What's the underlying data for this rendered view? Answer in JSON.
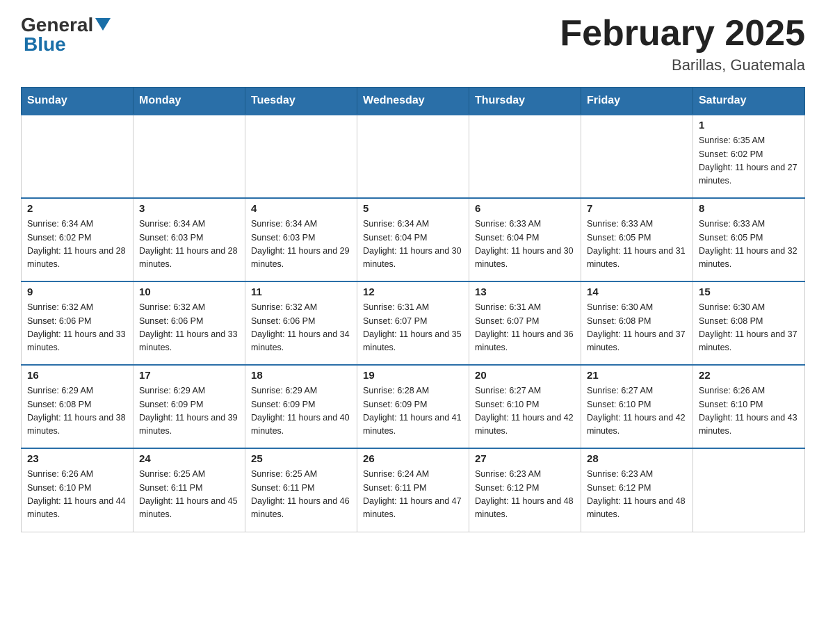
{
  "header": {
    "title": "February 2025",
    "subtitle": "Barillas, Guatemala",
    "logo_line1": "General",
    "logo_line2": "Blue"
  },
  "days_of_week": [
    "Sunday",
    "Monday",
    "Tuesday",
    "Wednesday",
    "Thursday",
    "Friday",
    "Saturday"
  ],
  "weeks": [
    [
      {
        "day": "",
        "sunrise": "",
        "sunset": "",
        "daylight": "",
        "empty": true
      },
      {
        "day": "",
        "sunrise": "",
        "sunset": "",
        "daylight": "",
        "empty": true
      },
      {
        "day": "",
        "sunrise": "",
        "sunset": "",
        "daylight": "",
        "empty": true
      },
      {
        "day": "",
        "sunrise": "",
        "sunset": "",
        "daylight": "",
        "empty": true
      },
      {
        "day": "",
        "sunrise": "",
        "sunset": "",
        "daylight": "",
        "empty": true
      },
      {
        "day": "",
        "sunrise": "",
        "sunset": "",
        "daylight": "",
        "empty": true
      },
      {
        "day": "1",
        "sunrise": "Sunrise: 6:35 AM",
        "sunset": "Sunset: 6:02 PM",
        "daylight": "Daylight: 11 hours and 27 minutes.",
        "empty": false
      }
    ],
    [
      {
        "day": "2",
        "sunrise": "Sunrise: 6:34 AM",
        "sunset": "Sunset: 6:02 PM",
        "daylight": "Daylight: 11 hours and 28 minutes.",
        "empty": false
      },
      {
        "day": "3",
        "sunrise": "Sunrise: 6:34 AM",
        "sunset": "Sunset: 6:03 PM",
        "daylight": "Daylight: 11 hours and 28 minutes.",
        "empty": false
      },
      {
        "day": "4",
        "sunrise": "Sunrise: 6:34 AM",
        "sunset": "Sunset: 6:03 PM",
        "daylight": "Daylight: 11 hours and 29 minutes.",
        "empty": false
      },
      {
        "day": "5",
        "sunrise": "Sunrise: 6:34 AM",
        "sunset": "Sunset: 6:04 PM",
        "daylight": "Daylight: 11 hours and 30 minutes.",
        "empty": false
      },
      {
        "day": "6",
        "sunrise": "Sunrise: 6:33 AM",
        "sunset": "Sunset: 6:04 PM",
        "daylight": "Daylight: 11 hours and 30 minutes.",
        "empty": false
      },
      {
        "day": "7",
        "sunrise": "Sunrise: 6:33 AM",
        "sunset": "Sunset: 6:05 PM",
        "daylight": "Daylight: 11 hours and 31 minutes.",
        "empty": false
      },
      {
        "day": "8",
        "sunrise": "Sunrise: 6:33 AM",
        "sunset": "Sunset: 6:05 PM",
        "daylight": "Daylight: 11 hours and 32 minutes.",
        "empty": false
      }
    ],
    [
      {
        "day": "9",
        "sunrise": "Sunrise: 6:32 AM",
        "sunset": "Sunset: 6:06 PM",
        "daylight": "Daylight: 11 hours and 33 minutes.",
        "empty": false
      },
      {
        "day": "10",
        "sunrise": "Sunrise: 6:32 AM",
        "sunset": "Sunset: 6:06 PM",
        "daylight": "Daylight: 11 hours and 33 minutes.",
        "empty": false
      },
      {
        "day": "11",
        "sunrise": "Sunrise: 6:32 AM",
        "sunset": "Sunset: 6:06 PM",
        "daylight": "Daylight: 11 hours and 34 minutes.",
        "empty": false
      },
      {
        "day": "12",
        "sunrise": "Sunrise: 6:31 AM",
        "sunset": "Sunset: 6:07 PM",
        "daylight": "Daylight: 11 hours and 35 minutes.",
        "empty": false
      },
      {
        "day": "13",
        "sunrise": "Sunrise: 6:31 AM",
        "sunset": "Sunset: 6:07 PM",
        "daylight": "Daylight: 11 hours and 36 minutes.",
        "empty": false
      },
      {
        "day": "14",
        "sunrise": "Sunrise: 6:30 AM",
        "sunset": "Sunset: 6:08 PM",
        "daylight": "Daylight: 11 hours and 37 minutes.",
        "empty": false
      },
      {
        "day": "15",
        "sunrise": "Sunrise: 6:30 AM",
        "sunset": "Sunset: 6:08 PM",
        "daylight": "Daylight: 11 hours and 37 minutes.",
        "empty": false
      }
    ],
    [
      {
        "day": "16",
        "sunrise": "Sunrise: 6:29 AM",
        "sunset": "Sunset: 6:08 PM",
        "daylight": "Daylight: 11 hours and 38 minutes.",
        "empty": false
      },
      {
        "day": "17",
        "sunrise": "Sunrise: 6:29 AM",
        "sunset": "Sunset: 6:09 PM",
        "daylight": "Daylight: 11 hours and 39 minutes.",
        "empty": false
      },
      {
        "day": "18",
        "sunrise": "Sunrise: 6:29 AM",
        "sunset": "Sunset: 6:09 PM",
        "daylight": "Daylight: 11 hours and 40 minutes.",
        "empty": false
      },
      {
        "day": "19",
        "sunrise": "Sunrise: 6:28 AM",
        "sunset": "Sunset: 6:09 PM",
        "daylight": "Daylight: 11 hours and 41 minutes.",
        "empty": false
      },
      {
        "day": "20",
        "sunrise": "Sunrise: 6:27 AM",
        "sunset": "Sunset: 6:10 PM",
        "daylight": "Daylight: 11 hours and 42 minutes.",
        "empty": false
      },
      {
        "day": "21",
        "sunrise": "Sunrise: 6:27 AM",
        "sunset": "Sunset: 6:10 PM",
        "daylight": "Daylight: 11 hours and 42 minutes.",
        "empty": false
      },
      {
        "day": "22",
        "sunrise": "Sunrise: 6:26 AM",
        "sunset": "Sunset: 6:10 PM",
        "daylight": "Daylight: 11 hours and 43 minutes.",
        "empty": false
      }
    ],
    [
      {
        "day": "23",
        "sunrise": "Sunrise: 6:26 AM",
        "sunset": "Sunset: 6:10 PM",
        "daylight": "Daylight: 11 hours and 44 minutes.",
        "empty": false
      },
      {
        "day": "24",
        "sunrise": "Sunrise: 6:25 AM",
        "sunset": "Sunset: 6:11 PM",
        "daylight": "Daylight: 11 hours and 45 minutes.",
        "empty": false
      },
      {
        "day": "25",
        "sunrise": "Sunrise: 6:25 AM",
        "sunset": "Sunset: 6:11 PM",
        "daylight": "Daylight: 11 hours and 46 minutes.",
        "empty": false
      },
      {
        "day": "26",
        "sunrise": "Sunrise: 6:24 AM",
        "sunset": "Sunset: 6:11 PM",
        "daylight": "Daylight: 11 hours and 47 minutes.",
        "empty": false
      },
      {
        "day": "27",
        "sunrise": "Sunrise: 6:23 AM",
        "sunset": "Sunset: 6:12 PM",
        "daylight": "Daylight: 11 hours and 48 minutes.",
        "empty": false
      },
      {
        "day": "28",
        "sunrise": "Sunrise: 6:23 AM",
        "sunset": "Sunset: 6:12 PM",
        "daylight": "Daylight: 11 hours and 48 minutes.",
        "empty": false
      },
      {
        "day": "",
        "sunrise": "",
        "sunset": "",
        "daylight": "",
        "empty": true
      }
    ]
  ]
}
